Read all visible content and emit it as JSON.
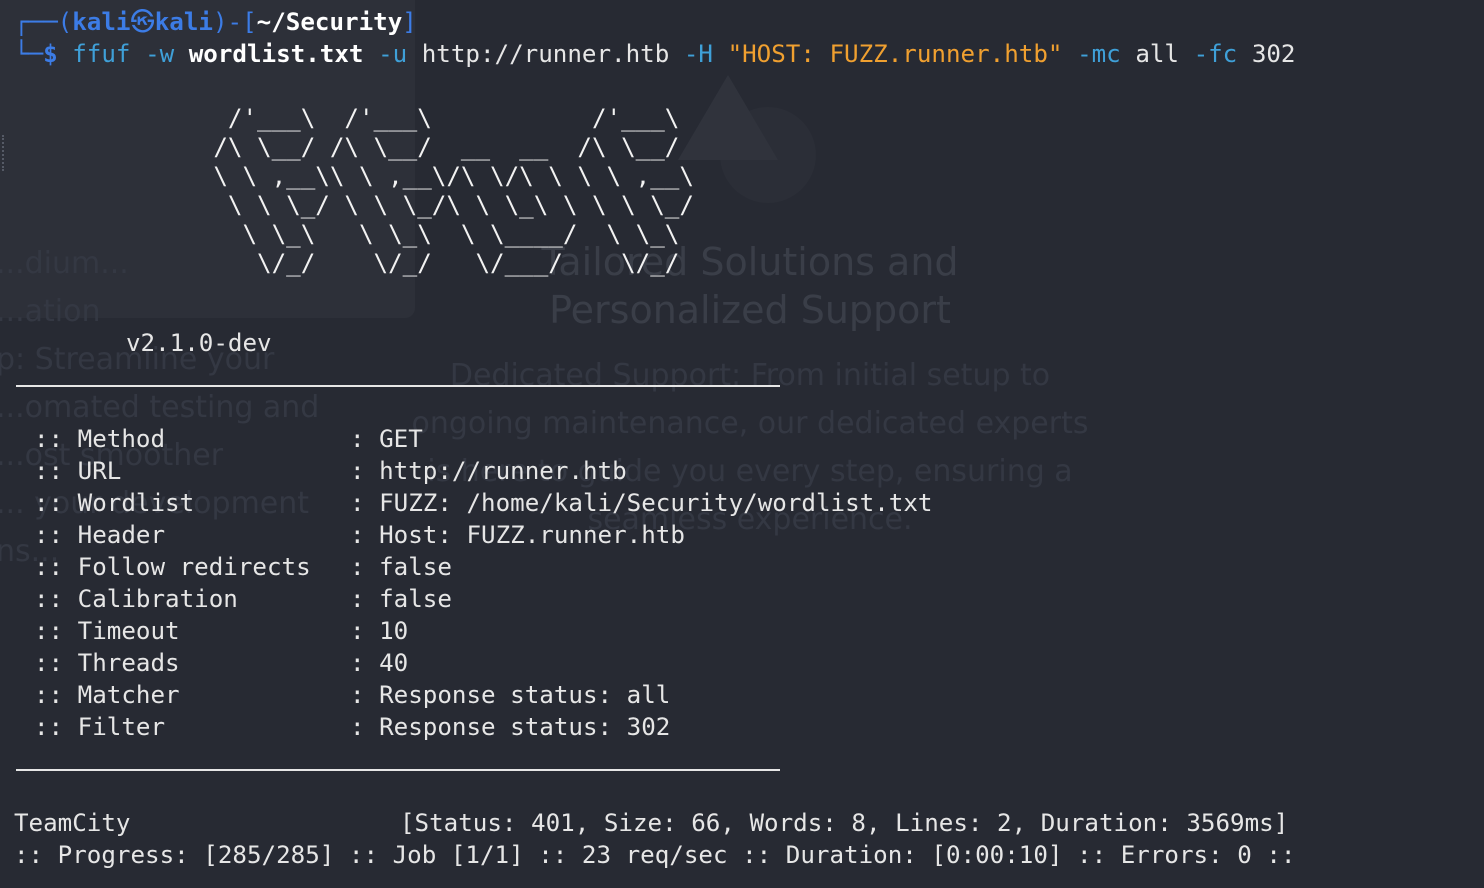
{
  "prompt": {
    "corner_top": "┌──(",
    "user": "kali",
    "at_symbol": "㉿",
    "host": "kali",
    "bracket_open": ")-[",
    "cwd": "~/Security",
    "bracket_close": "]",
    "corner_bottom": "└─",
    "dollar": "$"
  },
  "command": {
    "program": "ffuf",
    "flag_w": "-w",
    "wordlist": "wordlist.txt",
    "flag_u": "-u",
    "url": "http://runner.htb",
    "flag_h": "-H",
    "header": "\"HOST: FUZZ.runner.htb\"",
    "flag_mc": "-mc",
    "mc_value": "all",
    "flag_fc": "-fc",
    "fc_value": "302"
  },
  "banner_ascii": "       /'___\\  /'___\\           /'___\\\n      /\\ \\__/ /\\ \\__/  __  __  /\\ \\__/\n      \\ \\ ,__\\\\ \\ ,__\\/\\ \\/\\ \\ \\ \\ ,__\\\n       \\ \\ \\_/ \\ \\ \\_/\\ \\ \\_\\ \\ \\ \\ \\_/\n        \\ \\_\\   \\ \\_\\  \\ \\____/  \\ \\_\\\n         \\/_/    \\/_/   \\/___/    \\/_/",
  "version": "v2.1.0-dev",
  "config": [
    {
      "key": ":: Method",
      "value": ": GET"
    },
    {
      "key": ":: URL",
      "value": ": http://runner.htb"
    },
    {
      "key": ":: Wordlist",
      "value": ": FUZZ: /home/kali/Security/wordlist.txt"
    },
    {
      "key": ":: Header",
      "value": ": Host: FUZZ.runner.htb"
    },
    {
      "key": ":: Follow redirects",
      "value": ": false"
    },
    {
      "key": ":: Calibration",
      "value": ": false"
    },
    {
      "key": ":: Timeout",
      "value": ": 10"
    },
    {
      "key": ":: Threads",
      "value": ": 40"
    },
    {
      "key": ":: Matcher",
      "value": ": Response status: all"
    },
    {
      "key": ":: Filter",
      "value": ": Response status: 302"
    }
  ],
  "result": {
    "word": "TeamCity",
    "details": "[Status: 401, Size: 66, Words: 8, Lines: 2, Duration: 3569ms]"
  },
  "progress": ":: Progress: [285/285] :: Job [1/1] :: 23 req/sec :: Duration: [0:00:10] :: Errors: 0 ::",
  "background": {
    "title_line1": "Tailored Solutions and",
    "title_line2": "Personalized Support",
    "body": "Dedicated Support: From initial setup to ongoing maintenance, our dedicated experts is here to guide you every step, ensuring a seamless experience.",
    "left_text": "...dium...\n...ation\np: Streamline your\n...omated testing and\n...ost smoother\n... your development\nns..."
  },
  "colors": {
    "background": "#272a33",
    "prompt_blue": "#3c7ce6",
    "flag_cyan": "#3fa0d8",
    "string_orange": "#f0a030",
    "text": "#e6e6e6"
  }
}
